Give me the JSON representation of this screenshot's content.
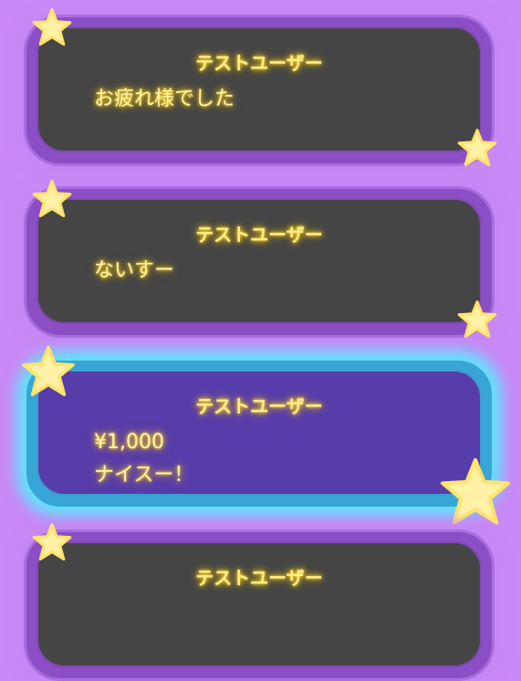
{
  "messages": [
    {
      "user": "テストユーザー",
      "text": "お疲れ様でした",
      "theme": "purple",
      "star_icon": "star-icon"
    },
    {
      "user": "テストユーザー",
      "text": "ないすー",
      "theme": "purple",
      "star_icon": "star-icon"
    },
    {
      "user": "テストユーザー",
      "amount": "¥1,000",
      "text": "ナイスー！",
      "theme": "blue",
      "star_icon": "star-icon"
    },
    {
      "user": "テストユーザー",
      "text": "",
      "theme": "purple",
      "star_icon": "star-icon"
    }
  ],
  "colors": {
    "background": "#c989f6",
    "purple_card": "#8c4ec5",
    "dark_inner": "#454545",
    "blue_card": "#37a6d6",
    "blue_inner": "#573da9",
    "text_glow": "#ffd93b",
    "star_fill": "#fff2a6"
  }
}
